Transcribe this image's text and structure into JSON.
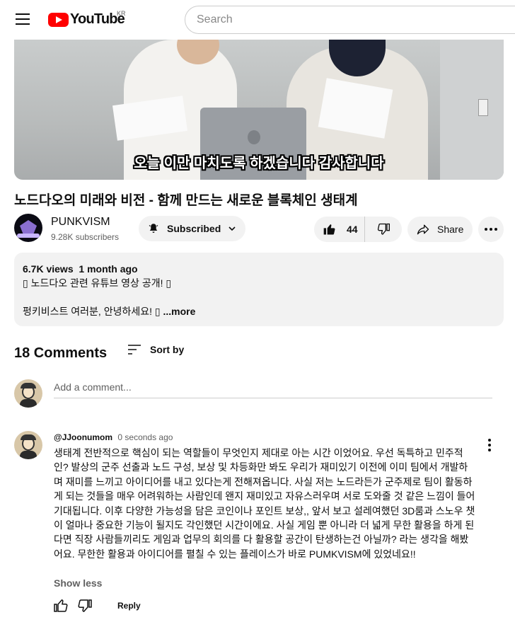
{
  "header": {
    "logo_text": "YouTube",
    "country_code": "KR",
    "search_placeholder": "Search"
  },
  "video": {
    "caption": "오늘 이만 마치도록 하겠습니다 감사합니다",
    "title": "노드다오의 미래와 비전 - 함께 만드는 새로운 블록체인 생태계"
  },
  "channel": {
    "name": "PUNKVISM",
    "subscribers": "9.28K subscribers",
    "subscribe_label": "Subscribed"
  },
  "actions": {
    "like_count": "44",
    "share_label": "Share"
  },
  "description": {
    "views": "6.7K views",
    "age": "1 month ago",
    "line1": "▯ 노드다오 관련 유튜브 영상 공개! ▯",
    "line2": "펑키비스트 여러분, 안녕하세요! ▯",
    "more_label": "...more"
  },
  "comments": {
    "count_label": "18 Comments",
    "sort_label": "Sort by",
    "add_placeholder": "Add a comment...",
    "items": [
      {
        "author": "@JJoonumom",
        "time": "0 seconds ago",
        "text": "생태계 전반적으로 핵심이 되는 역할들이 무엇인지 제대로 아는 시간 이었어요. 우선 독특하고 민주적인? 발상의 군주 선출과 노드 구성, 보상 및 차등화만 봐도 우리가 재미있기 이전에 이미 팀에서 개발하며 재미를 느끼고 아이디어를 내고 있다는게 전해져옵니다.  사실 저는 노드라든가 군주제로 팀이 활동하게 되는 것들을 매우 어려워하는 사람인데 왠지 재미있고 자유스러우며 서로 도와줄 것 같은 느낌이 들어 기대됩니다.  이후 다양한 가능성을 담은 코인이나 포인트 보상,,  앞서 보고 설레여했던 3D룸과 스노우 챗이 얼마나 중요한 기능이 될지도 각인했던 시간이에요.  사실 게임 뿐 아니라 더 넓게 무한 활용을 하게 된다면 직장 사람들끼리도 게임과 업무의 회의를 다 활용할 공간이 탄생하는건 아닐까? 라는 생각을 해봤어요.  무한한 활용과 아이디어를 펼칠 수 있는 플레이스가 바로 PUMKVISM에 있었네요!!",
        "show_less_label": "Show less",
        "reply_label": "Reply"
      }
    ]
  },
  "colors": {
    "brand_red": "#ff0000",
    "pill_bg": "#f2f2f2",
    "text_secondary": "#606060"
  }
}
